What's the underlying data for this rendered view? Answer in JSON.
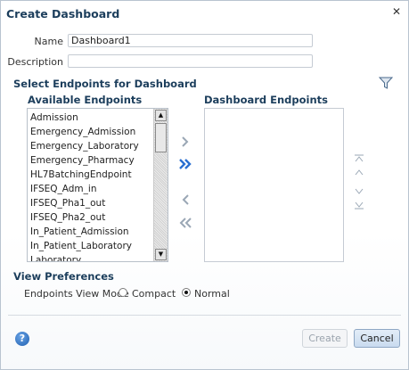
{
  "dialog": {
    "title": "Create Dashboard",
    "close_icon": "close-icon"
  },
  "form": {
    "name_label": "Name",
    "name_value": "Dashboard1",
    "description_label": "Description",
    "description_value": ""
  },
  "endpoints": {
    "section_title": "Select Endpoints for Dashboard",
    "available_header": "Available Endpoints",
    "dashboard_header": "Dashboard Endpoints",
    "available_items": [
      "Admission",
      "Emergency_Admission",
      "Emergency_Laboratory",
      "Emergency_Pharmacy",
      "HL7BatchingEndpoint",
      "IFSEQ_Adm_in",
      "IFSEQ_Pha1_out",
      "IFSEQ_Pha2_out",
      "In_Patient_Admission",
      "In_Patient_Laboratory",
      "Laboratory"
    ],
    "dashboard_items": []
  },
  "preferences": {
    "section_title": "View Preferences",
    "mode_label": "Endpoints View Mode",
    "options": [
      "Compact",
      "Normal"
    ],
    "selected": "Normal"
  },
  "buttons": {
    "create": "Create",
    "cancel": "Cancel",
    "help": "?"
  },
  "colors": {
    "accent": "#1c3e5c",
    "shuttle_blue": "#2a6fd1",
    "shuttle_gray": "#9aa7b5"
  }
}
